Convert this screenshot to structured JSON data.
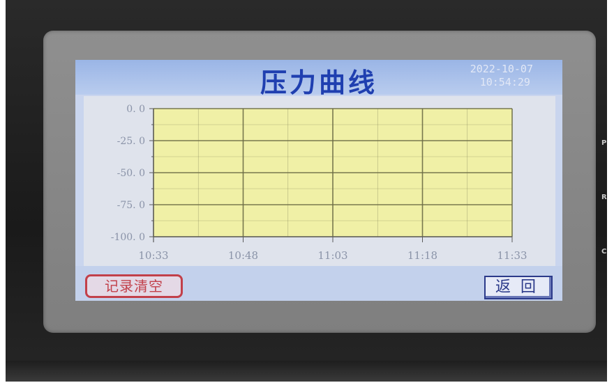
{
  "screen": {
    "title": "压力曲线",
    "date": "2022-10-07",
    "time": "10:54:29"
  },
  "chart_data": {
    "type": "line",
    "title": "",
    "xlabel": "",
    "ylabel": "",
    "x_ticks": [
      "10:33",
      "10:48",
      "11:03",
      "11:18",
      "11:33"
    ],
    "y_ticks": [
      "0. 0",
      "-25. 0",
      "-50. 0",
      "-75. 0",
      "-100. 0"
    ],
    "ylim": [
      -100,
      0
    ],
    "xlim": [
      "10:33",
      "11:33"
    ],
    "grid": true,
    "plot_background": "#f0f0a6",
    "grid_color": "#6a6a45",
    "series": [
      {
        "values": [],
        "color": "#6a6a45"
      }
    ]
  },
  "buttons": {
    "clear_records": "记录清空",
    "return": "返回"
  }
}
